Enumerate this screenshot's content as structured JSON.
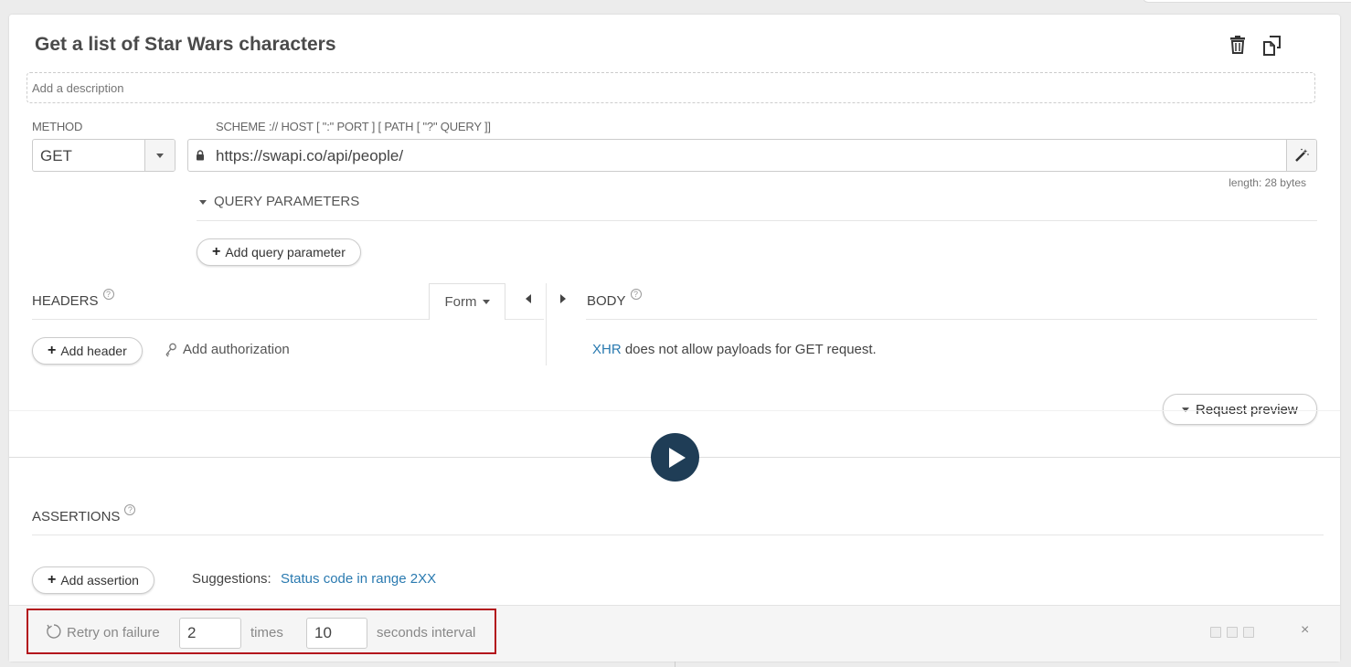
{
  "request": {
    "title": "Get a list of Star Wars characters",
    "description_placeholder": "Add a description",
    "method_label": "METHOD",
    "method_value": "GET",
    "url_label": "SCHEME :// HOST [ \":\" PORT ] [ PATH [ \"?\" QUERY ]]",
    "url_value": "https://swapi.co/api/people/",
    "length_text": "length: 28 bytes"
  },
  "toolbar": {
    "delete_icon": "trash-icon",
    "duplicate_icon": "copy-icon"
  },
  "query_params": {
    "label": "QUERY PARAMETERS",
    "add_label": "Add query parameter"
  },
  "headers": {
    "label": "HEADERS",
    "help": "?",
    "mode": "Form",
    "add_label": "Add header",
    "auth_label": "Add authorization"
  },
  "body": {
    "label": "BODY",
    "help": "?",
    "xhr_link": "XHR",
    "message": " does not allow payloads for GET request."
  },
  "preview": {
    "label": "Request preview"
  },
  "assertions": {
    "label": "ASSERTIONS",
    "help": "?",
    "add_label": "Add assertion",
    "suggestions_label": "Suggestions:",
    "suggestion": "Status code in range 2XX"
  },
  "retry": {
    "label": "Retry on failure",
    "times_value": "2",
    "times_label": "times",
    "interval_value": "10",
    "interval_label": "seconds interval",
    "highlight_color": "#b3141c"
  },
  "footer": {
    "close": "×"
  },
  "colors": {
    "link": "#2a7ab0",
    "play_button": "#1f3d56"
  }
}
